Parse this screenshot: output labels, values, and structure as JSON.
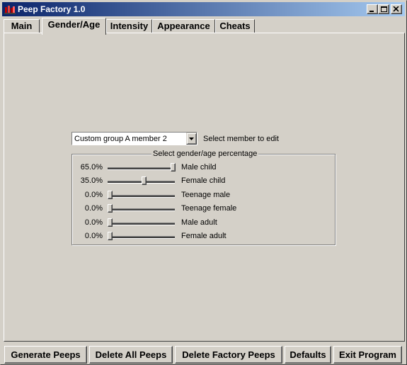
{
  "window": {
    "title": "Peep Factory 1.0",
    "caption_buttons": [
      {
        "name": "minimize",
        "icon": "minimize-icon"
      },
      {
        "name": "maximize",
        "icon": "maximize-icon"
      },
      {
        "name": "close",
        "icon": "close-icon"
      }
    ]
  },
  "tabs": [
    {
      "label": "Main",
      "active": false
    },
    {
      "label": "Gender/Age",
      "active": true
    },
    {
      "label": "Intensity",
      "active": false
    },
    {
      "label": "Appearance",
      "active": false
    },
    {
      "label": "Cheats",
      "active": false
    }
  ],
  "member_select": {
    "value": "Custom group A member 2",
    "label": "Select member to edit"
  },
  "gender_age": {
    "title": "Select gender/age percentage",
    "rows": [
      {
        "percent_text": "65.0%",
        "value": 1.0,
        "label": "Male child"
      },
      {
        "percent_text": "35.0%",
        "value": 0.54,
        "label": "Female child"
      },
      {
        "percent_text": "0.0%",
        "value": 0.0,
        "label": "Teenage male"
      },
      {
        "percent_text": "0.0%",
        "value": 0.0,
        "label": "Teenage female"
      },
      {
        "percent_text": "0.0%",
        "value": 0.0,
        "label": "Male adult"
      },
      {
        "percent_text": "0.0%",
        "value": 0.0,
        "label": "Female adult"
      }
    ]
  },
  "buttons": {
    "generate": "Generate Peeps",
    "delete_all": "Delete All Peeps",
    "delete_factory": "Delete Factory Peeps",
    "defaults": "Defaults",
    "exit": "Exit Program"
  },
  "colors": {
    "face": "#d4d0c8",
    "title_start": "#0a246a",
    "title_end": "#a6caf0"
  }
}
